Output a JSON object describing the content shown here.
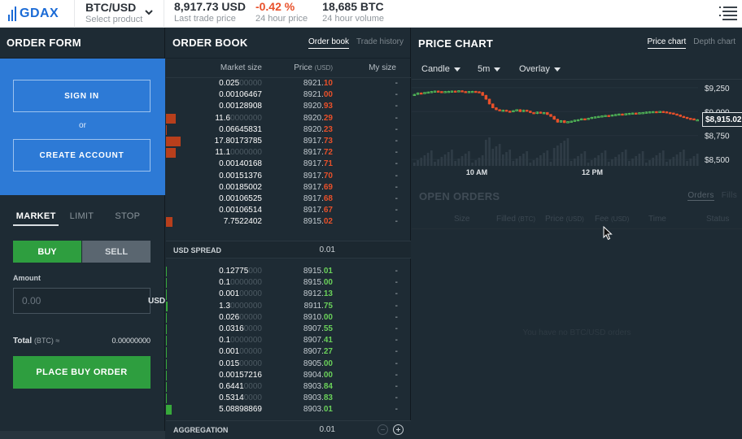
{
  "header": {
    "logo": "GDAX",
    "product": "BTC/USD",
    "product_sub": "Select product",
    "last_price": "8,917.73 USD",
    "last_price_sub": "Last trade price",
    "change": "-0.42 %",
    "change_sub": "24 hour price",
    "volume": "18,685 BTC",
    "volume_sub": "24 hour volume"
  },
  "order_form": {
    "title": "ORDER FORM",
    "sign_in": "SIGN IN",
    "or": "or",
    "create_account": "CREATE ACCOUNT",
    "tabs": [
      "MARKET",
      "LIMIT",
      "STOP"
    ],
    "buy": "BUY",
    "sell": "SELL",
    "amount_label": "Amount",
    "amount_placeholder": "0.00",
    "amount_unit": "USD",
    "total_label": "Total",
    "total_unit": "(BTC) ≈",
    "total_value": "0.00000000",
    "place_order": "PLACE BUY ORDER"
  },
  "order_book": {
    "title": "ORDER BOOK",
    "tabs": [
      "Order book",
      "Trade history"
    ],
    "col_market_size": "Market size",
    "col_price": "Price",
    "col_price_unit": "(USD)",
    "col_my_size": "My size",
    "spread_label": "USD SPREAD",
    "spread_value": "0.01",
    "aggregation_label": "AGGREGATION",
    "aggregation_value": "0.01",
    "asks": [
      {
        "size_b": "0.025",
        "size_d": "00000",
        "price_b": "8921.",
        "price_d": "10",
        "my": "-",
        "depth": 0
      },
      {
        "size_b": "0.00106467",
        "size_d": "",
        "price_b": "8921.",
        "price_d": "00",
        "my": "-",
        "depth": 0
      },
      {
        "size_b": "0.00128908",
        "size_d": "",
        "price_b": "8920.",
        "price_d": "93",
        "my": "-",
        "depth": 0
      },
      {
        "size_b": "11.6",
        "size_d": "0000000",
        "price_b": "8920.",
        "price_d": "29",
        "my": "-",
        "depth": 0.6
      },
      {
        "size_b": "0.06645831",
        "size_d": "",
        "price_b": "8920.",
        "price_d": "23",
        "my": "-",
        "depth": 0.05
      },
      {
        "size_b": "17.80173785",
        "size_d": "",
        "price_b": "8917.",
        "price_d": "73",
        "my": "-",
        "depth": 0.9
      },
      {
        "size_b": "11.1",
        "size_d": "0000000",
        "price_b": "8917.",
        "price_d": "72",
        "my": "-",
        "depth": 0.6
      },
      {
        "size_b": "0.00140168",
        "size_d": "",
        "price_b": "8917.",
        "price_d": "71",
        "my": "-",
        "depth": 0
      },
      {
        "size_b": "0.00151376",
        "size_d": "",
        "price_b": "8917.",
        "price_d": "70",
        "my": "-",
        "depth": 0
      },
      {
        "size_b": "0.00185002",
        "size_d": "",
        "price_b": "8917.",
        "price_d": "69",
        "my": "-",
        "depth": 0
      },
      {
        "size_b": "0.00106525",
        "size_d": "",
        "price_b": "8917.",
        "price_d": "68",
        "my": "-",
        "depth": 0
      },
      {
        "size_b": "0.00106514",
        "size_d": "",
        "price_b": "8917.",
        "price_d": "67",
        "my": "-",
        "depth": 0
      },
      {
        "size_b": "7.7522402",
        "size_d": "",
        "price_b": "8915.",
        "price_d": "02",
        "my": "-",
        "depth": 0.4
      }
    ],
    "bids": [
      {
        "size_b": "0.12775",
        "size_d": "000",
        "price_b": "8915.",
        "price_d": "01",
        "my": "-",
        "depth": 0.05
      },
      {
        "size_b": "0.1",
        "size_d": "0000000",
        "price_b": "8915.",
        "price_d": "00",
        "my": "-",
        "depth": 0.05
      },
      {
        "size_b": "0.001",
        "size_d": "00000",
        "price_b": "8912.",
        "price_d": "13",
        "my": "-",
        "depth": 0.05
      },
      {
        "size_b": "1.3",
        "size_d": "0000000",
        "price_b": "8911.",
        "price_d": "75",
        "my": "-",
        "depth": 0.08
      },
      {
        "size_b": "0.026",
        "size_d": "00000",
        "price_b": "8910.",
        "price_d": "00",
        "my": "-",
        "depth": 0.05
      },
      {
        "size_b": "0.0316",
        "size_d": "0000",
        "price_b": "8907.",
        "price_d": "55",
        "my": "-",
        "depth": 0.05
      },
      {
        "size_b": "0.1",
        "size_d": "0000000",
        "price_b": "8907.",
        "price_d": "41",
        "my": "-",
        "depth": 0.05
      },
      {
        "size_b": "0.001",
        "size_d": "00000",
        "price_b": "8907.",
        "price_d": "27",
        "my": "-",
        "depth": 0.05
      },
      {
        "size_b": "0.015",
        "size_d": "00000",
        "price_b": "8905.",
        "price_d": "00",
        "my": "-",
        "depth": 0.05
      },
      {
        "size_b": "0.00157216",
        "size_d": "",
        "price_b": "8904.",
        "price_d": "00",
        "my": "-",
        "depth": 0.05
      },
      {
        "size_b": "0.6441",
        "size_d": "0000",
        "price_b": "8903.",
        "price_d": "84",
        "my": "-",
        "depth": 0.05
      },
      {
        "size_b": "0.5314",
        "size_d": "0000",
        "price_b": "8903.",
        "price_d": "83",
        "my": "-",
        "depth": 0.05
      },
      {
        "size_b": "5.08898869",
        "size_d": "",
        "price_b": "8903.",
        "price_d": "01",
        "my": "-",
        "depth": 0.35
      }
    ]
  },
  "price_chart": {
    "title": "PRICE CHART",
    "tabs": [
      "Price chart",
      "Depth chart"
    ],
    "chart_type": "Candle",
    "interval": "5m",
    "overlay": "Overlay",
    "y_ticks": [
      "$9,250",
      "$9,000",
      "$8,750",
      "$8,500"
    ],
    "y_tick_values": [
      9250,
      9000,
      8750,
      8500
    ],
    "x_ticks": [
      "10 AM",
      "12 PM"
    ],
    "current_price": "$8,915.02",
    "current_price_value": 8915.02
  },
  "open_orders": {
    "title": "OPEN ORDERS",
    "tabs": [
      "Orders",
      "Fills"
    ],
    "columns": [
      "Size",
      "Filled",
      "Price",
      "Fee",
      "Time",
      "Status"
    ],
    "column_units": [
      "",
      "(BTC)",
      "(USD)",
      "(USD)",
      "",
      ""
    ],
    "empty_message": "You have no BTC/USD orders"
  },
  "colors": {
    "brand": "#1b6bd6",
    "buy": "#2e9e3f",
    "ask": "#e8502a",
    "bid": "#6ad15a",
    "panel": "#1e2b34"
  }
}
